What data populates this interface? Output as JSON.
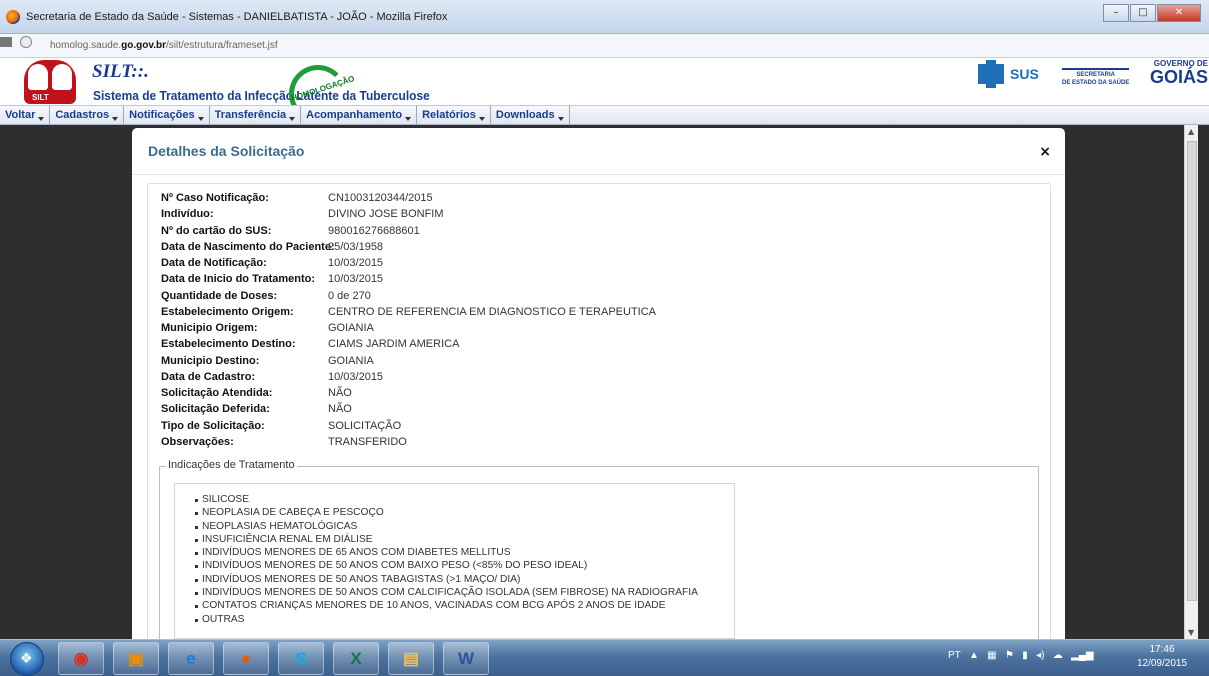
{
  "window": {
    "title": "Secretaria de Estado da Saúde - Sistemas - DANIELBATISTA - JOÃO - Mozilla Firefox",
    "url_prefix": "homolog.saude.",
    "url_domain": "go.gov.br",
    "url_path": "/silt/estrutura/frameset.jsf"
  },
  "header": {
    "app_short": "SILT::.",
    "app_full": "Sistema de Tratamento da Infecção Latente da Tuberculose",
    "logo_text": "SILT",
    "homolog_stamp": "HOMOLOGAÇÃO",
    "sus_text": "SUS",
    "secretaria_line1": "SECRETARIA",
    "secretaria_line2": "DE ESTADO DA SAÚDE",
    "gov_small": "GOVERNO DE",
    "gov_big": "GOIÁS"
  },
  "menu": [
    {
      "label": "Voltar"
    },
    {
      "label": "Cadastros"
    },
    {
      "label": "Notificações"
    },
    {
      "label": "Transferência"
    },
    {
      "label": "Acompanhamento"
    },
    {
      "label": "Relatórios"
    },
    {
      "label": "Downloads"
    }
  ],
  "modal": {
    "title": "Detalhes da Solicitação",
    "close_glyph": "×",
    "fields": [
      {
        "label": "Nº Caso Notificação:",
        "value": "CN1003120344/2015"
      },
      {
        "label": "Indivíduo:",
        "value": "DIVINO JOSE BONFIM"
      },
      {
        "label": "Nº do cartão do SUS:",
        "value": "980016276688601"
      },
      {
        "label": "Data de Nascimento do Paciente:",
        "value": "25/03/1958"
      },
      {
        "label": "Data de Notificação:",
        "value": "10/03/2015"
      },
      {
        "label": "Data de Inicio do Tratamento:",
        "value": "10/03/2015"
      },
      {
        "label": "Quantidade de Doses:",
        "value": "0 de 270"
      },
      {
        "label": "Estabelecimento Origem:",
        "value": "CENTRO DE REFERENCIA EM DIAGNOSTICO E TERAPEUTICA"
      },
      {
        "label": "Municipio Origem:",
        "value": "GOIANIA"
      },
      {
        "label": "Estabelecimento Destino:",
        "value": "CIAMS JARDIM AMERICA"
      },
      {
        "label": "Municipio Destino:",
        "value": "GOIANIA"
      },
      {
        "label": "Data de Cadastro:",
        "value": "10/03/2015"
      },
      {
        "label": "Solicitação Atendida:",
        "value": "NÃO"
      },
      {
        "label": "Solicitação Deferida:",
        "value": "NÃO"
      },
      {
        "label": "Tipo de Solicitação:",
        "value": "SOLICITAÇÃO"
      },
      {
        "label": "Observações:",
        "value": "TRANSFERIDO"
      }
    ],
    "indicacoes_legend": "Indicações de Tratamento",
    "indicacoes": [
      "SILICOSE",
      "NEOPLASIA DE CABEÇA E PESCOÇO",
      "NEOPLASIAS HEMATOLÓGICAS",
      "INSUFICIÊNCIA RENAL EM DIÁLISE",
      "INDIVÍDUOS MENORES DE 65 ANOS COM DIABETES MELLITUS",
      "INDIVÍDUOS MENORES DE 50 ANOS COM BAIXO PESO (<85% DO PESO IDEAL)",
      "INDIVÍDUOS MENORES DE 50 ANOS TABAGISTAS (>1 MAÇO/ DIA)",
      "INDIVÍDUOS MENORES DE 50 ANOS COM CALCIFICAÇÃO ISOLADA (SEM FIBROSE) NA RADIOGRAFIA",
      "CONTATOS CRIANÇAS MENORES DE 10 ANOS, VACINADAS COM BCG APÓS 2 ANOS DE IDADE",
      "OUTRAS"
    ]
  },
  "taskbar": {
    "tray_lang": "PT",
    "time": "17:46",
    "date": "12/09/2015",
    "apps": [
      "chrome-icon",
      "media-player-icon",
      "ie-icon",
      "firefox-icon",
      "skype-icon",
      "excel-icon",
      "explorer-icon",
      "word-icon"
    ]
  },
  "colors": {
    "accent_blue": "#1a3b8f",
    "modal_title": "#3a6c93",
    "overlay": "#2e2e2e"
  }
}
